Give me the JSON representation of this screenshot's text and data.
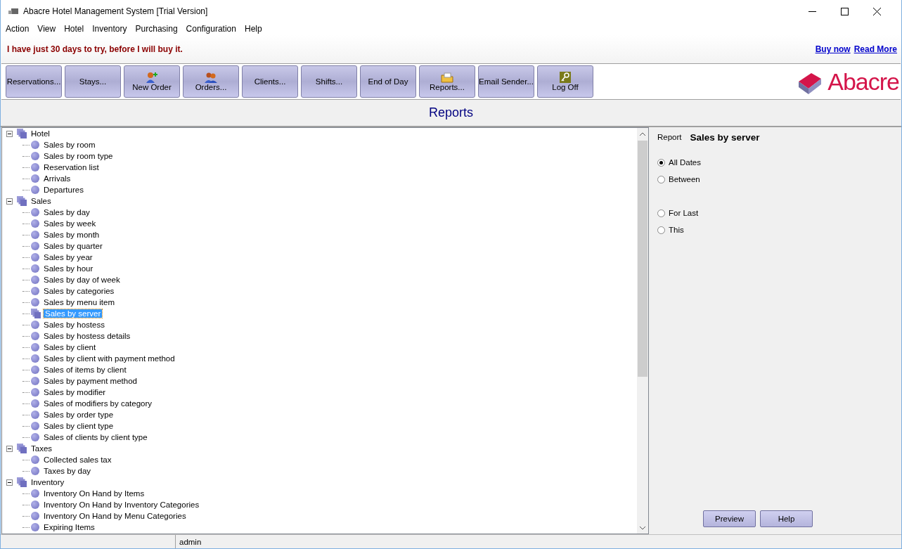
{
  "window": {
    "title": "Abacre Hotel Management System [Trial Version]"
  },
  "menu": [
    "Action",
    "View",
    "Hotel",
    "Inventory",
    "Purchasing",
    "Configuration",
    "Help"
  ],
  "trial_notice": {
    "message": "I have just 30 days to try, before I will buy it.",
    "links": [
      "Buy now",
      "Read More"
    ]
  },
  "toolbar": [
    {
      "label": "Reservations...",
      "kind": "plain"
    },
    {
      "label": "Stays...",
      "kind": "plain"
    },
    {
      "label": "New Order",
      "kind": "add"
    },
    {
      "label": "Orders...",
      "kind": "group"
    },
    {
      "label": "Clients...",
      "kind": "plain"
    },
    {
      "label": "Shifts...",
      "kind": "plain"
    },
    {
      "label": "End of Day",
      "kind": "plain"
    },
    {
      "label": "Reports...",
      "kind": "folder"
    },
    {
      "label": "Email Sender...",
      "kind": "plain"
    },
    {
      "label": "Log Off",
      "kind": "key"
    }
  ],
  "logo": {
    "text": "Abacre"
  },
  "heading": "Reports",
  "tree": [
    {
      "label": "Hotel",
      "expanded": true,
      "children": [
        {
          "label": "Sales by room",
          "selected": false
        },
        {
          "label": "Sales by room type",
          "selected": false
        },
        {
          "label": "Reservation list",
          "selected": false
        },
        {
          "label": "Arrivals",
          "selected": false
        },
        {
          "label": "Departures",
          "selected": false
        }
      ]
    },
    {
      "label": "Sales",
      "expanded": true,
      "children": [
        {
          "label": "Sales by day",
          "selected": false
        },
        {
          "label": "Sales by week",
          "selected": false
        },
        {
          "label": "Sales by month",
          "selected": false
        },
        {
          "label": "Sales by quarter",
          "selected": false
        },
        {
          "label": "Sales by year",
          "selected": false
        },
        {
          "label": "Sales by hour",
          "selected": false
        },
        {
          "label": "Sales by day of week",
          "selected": false
        },
        {
          "label": "Sales by categories",
          "selected": false
        },
        {
          "label": "Sales by menu item",
          "selected": false
        },
        {
          "label": "Sales by server",
          "selected": true
        },
        {
          "label": "Sales by hostess",
          "selected": false
        },
        {
          "label": "Sales by hostess details",
          "selected": false
        },
        {
          "label": "Sales by client",
          "selected": false
        },
        {
          "label": "Sales by client with payment method",
          "selected": false
        },
        {
          "label": "Sales of items by client",
          "selected": false
        },
        {
          "label": "Sales by payment method",
          "selected": false
        },
        {
          "label": "Sales by modifier",
          "selected": false
        },
        {
          "label": "Sales of modifiers by category",
          "selected": false
        },
        {
          "label": "Sales by order type",
          "selected": false
        },
        {
          "label": "Sales by client type",
          "selected": false
        },
        {
          "label": "Sales of clients by client type",
          "selected": false
        }
      ]
    },
    {
      "label": "Taxes",
      "expanded": true,
      "children": [
        {
          "label": "Collected sales tax",
          "selected": false
        },
        {
          "label": "Taxes by day",
          "selected": false
        }
      ]
    },
    {
      "label": "Inventory",
      "expanded": true,
      "children": [
        {
          "label": "Inventory On Hand by Items",
          "selected": false
        },
        {
          "label": "Inventory On Hand by Inventory Categories",
          "selected": false
        },
        {
          "label": "Inventory On Hand by Menu Categories",
          "selected": false
        },
        {
          "label": "Expiring Items",
          "selected": false
        }
      ]
    }
  ],
  "report_panel": {
    "label": "Report",
    "name": "Sales by server",
    "options": [
      {
        "label": "All Dates",
        "selected": true
      },
      {
        "label": "Between",
        "selected": false
      },
      {
        "label": "For Last",
        "selected": false
      },
      {
        "label": "This",
        "selected": false
      }
    ],
    "buttons": [
      "Preview",
      "Help"
    ]
  },
  "status_bar": {
    "user": "admin"
  }
}
